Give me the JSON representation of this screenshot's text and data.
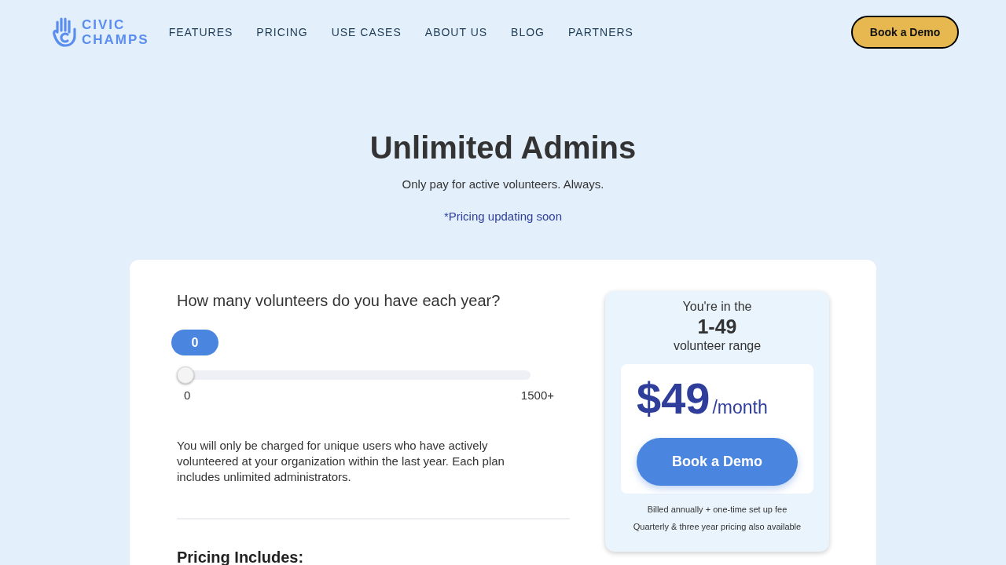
{
  "header": {
    "logo_lines": [
      "CIVIC",
      "CHAMPS"
    ],
    "nav": [
      "FEATURES",
      "PRICING",
      "USE CASES",
      "ABOUT US",
      "BLOG",
      "PARTNERS"
    ],
    "cta": "Book a Demo"
  },
  "hero": {
    "title": "Unlimited Admins",
    "subtitle": "Only pay for active volunteers. Always.",
    "note": "*Pricing updating soon"
  },
  "calculator": {
    "question": "How many volunteers do you have each year?",
    "slider": {
      "value_label": "0",
      "level": 0,
      "min_label": "0",
      "max_label": "1500+"
    },
    "description": "You will only be charged for unique users who have actively volunteered at your organization within the last year. Each plan includes unlimited administrators.",
    "section_heading": "Pricing Includes:"
  },
  "plan": {
    "intro": "You're in the",
    "range": "1-49",
    "range_suffix": "volunteer range",
    "price": "$49",
    "period": "/month",
    "button": "Book a Demo",
    "notes": [
      "Billed annually + one-time set up fee",
      "Quarterly & three year pricing also available"
    ]
  }
}
